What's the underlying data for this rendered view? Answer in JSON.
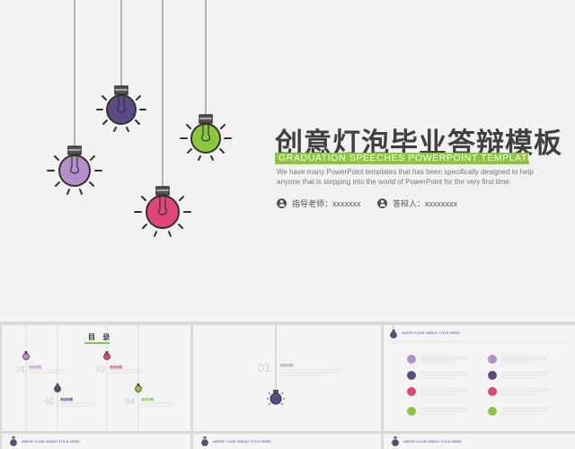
{
  "main": {
    "title": "创意灯泡毕业答辩模板",
    "subtitle": "GRADUATION SPEECHES POWERPOINT TEMPLATE",
    "description": "We have many PowerPoint templates that has been specifically designed to help anyone that is stepping into the world of PowerPoint for the very first time.",
    "advisor_label": "指导老师：xxxxxxx",
    "defender_label": "答辩人：xxxxxxxx"
  },
  "colors": {
    "purple_dark": "#5c4a87",
    "purple_light": "#b48fc9",
    "pink": "#e0457b",
    "green": "#8cc63f",
    "title_text": "#404040"
  },
  "thumb_toc": {
    "title": "目 录",
    "items": [
      {
        "num": "01",
        "label": "添加标题"
      },
      {
        "num": "02",
        "label": "添加标题"
      },
      {
        "num": "03",
        "label": "添加标题"
      },
      {
        "num": "04",
        "label": "添加标题"
      }
    ]
  },
  "thumb_section": {
    "num": "01",
    "label": "添加标题"
  },
  "thumb_list": {
    "head_title": "WRITE YOUR GREAT TITLE HERE"
  },
  "bottom_strip": {
    "title_left": "WRITE YOUR GREAT TITLE HERE",
    "title_right": "WRITE YOUR GREAT TITLE HERE"
  }
}
